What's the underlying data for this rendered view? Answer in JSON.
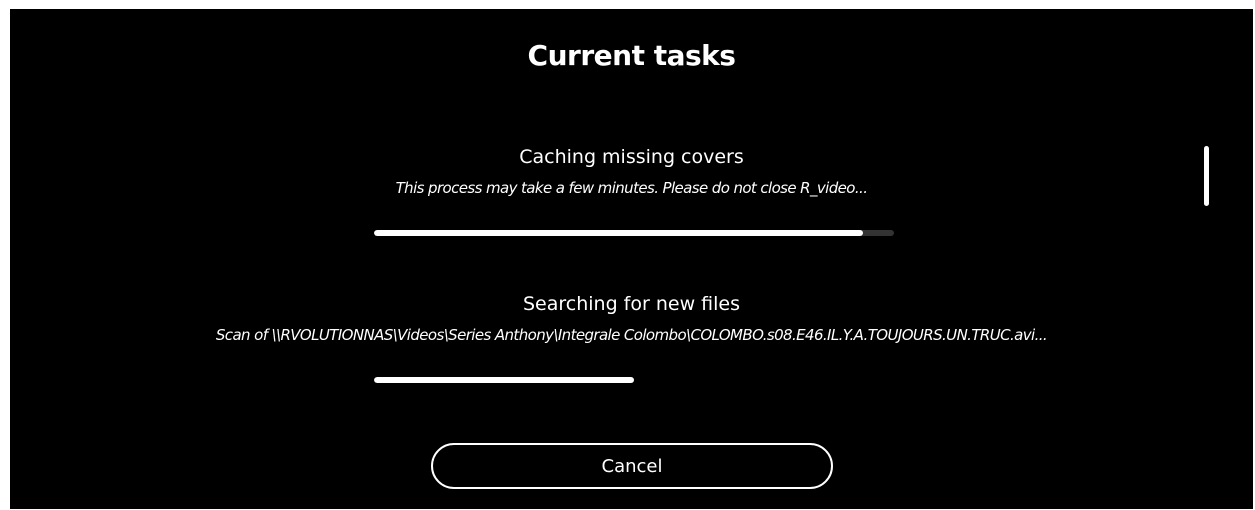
{
  "dialog": {
    "title": "Current tasks"
  },
  "tasks": [
    {
      "title": "Caching missing covers",
      "description": "This process may take a few minutes. Please do not close R_video...",
      "progress": 0.94,
      "track_color": "#333333"
    },
    {
      "title": "Searching for new files",
      "description": "Scan of \\\\RVOLUTIONNAS\\Videos\\Series Anthony\\Integrale Colombo\\COLOMBO.s08.E46.IL.Y.A.TOUJOURS.UN.TRUC.avi...",
      "progress": 0.5,
      "track_color": "#000000"
    }
  ],
  "buttons": {
    "cancel_label": "Cancel"
  },
  "colors": {
    "background": "#000000",
    "foreground": "#ffffff"
  }
}
